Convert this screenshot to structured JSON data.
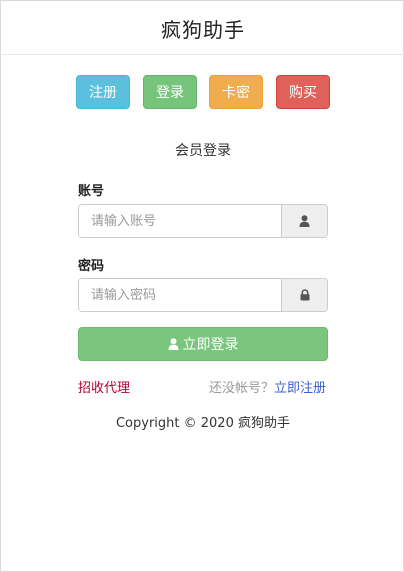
{
  "header": {
    "title": "疯狗助手"
  },
  "nav": {
    "register": "注册",
    "login": "登录",
    "card_key": "卡密",
    "buy": "购买"
  },
  "form": {
    "title": "会员登录",
    "account_label": "账号",
    "account_placeholder": "请输入账号",
    "password_label": "密码",
    "password_placeholder": "请输入密码",
    "submit_label": "立即登录"
  },
  "links": {
    "agent": "招收代理",
    "no_account_hint": "还没帐号？",
    "register_now": "立即注册"
  },
  "footer": {
    "copyright": "Copyright © 2020 疯狗助手"
  },
  "icons": {
    "account_addon": "user-icon",
    "password_addon": "lock-icon",
    "submit": "user-icon"
  },
  "colors": {
    "register": "#5bc0de",
    "login": "#77c57c",
    "card_key": "#f0ad4e",
    "buy": "#e0605c",
    "submit": "#7bc67e",
    "agent_link": "#b5002e",
    "register_link": "#3b5fd9"
  }
}
